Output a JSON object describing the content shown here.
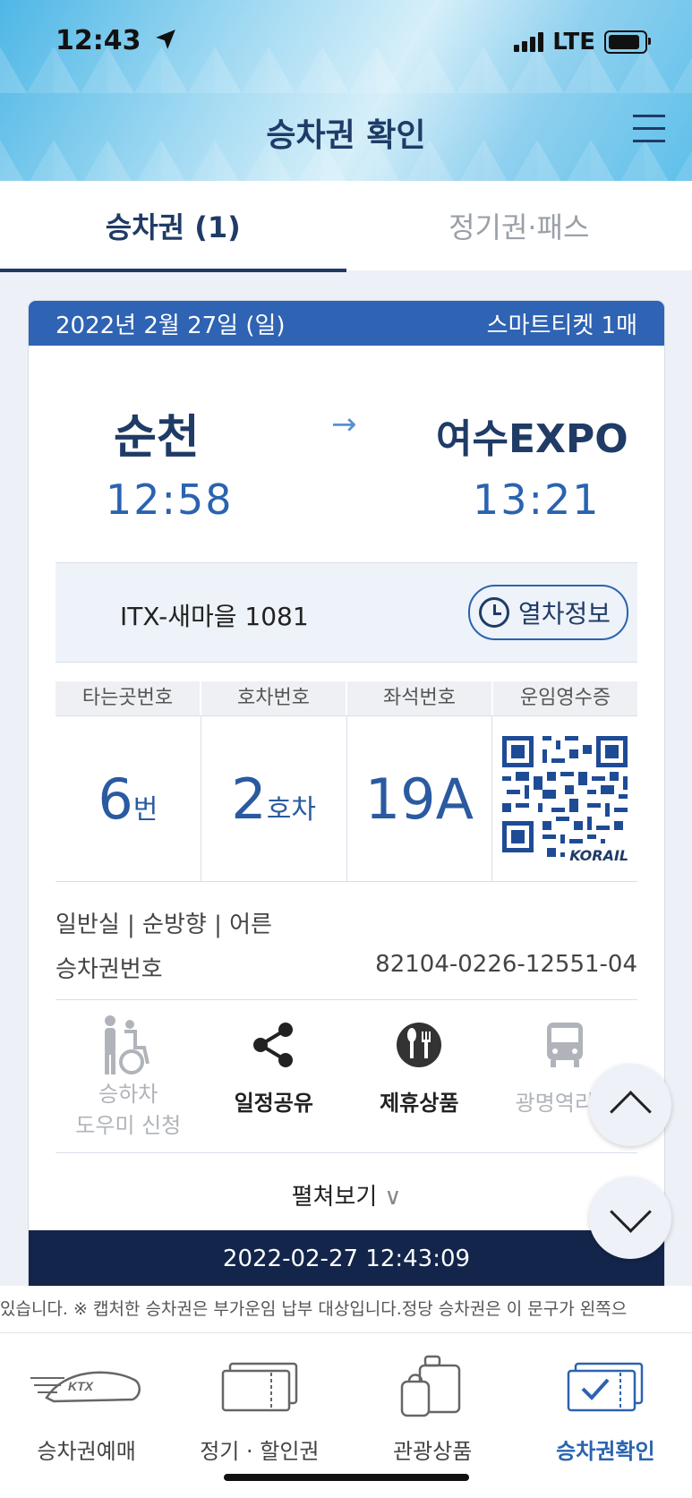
{
  "status": {
    "time": "12:43",
    "network": "LTE"
  },
  "header": {
    "title": "승차권 확인"
  },
  "tabs": [
    {
      "label": "승차권 (1)",
      "active": true
    },
    {
      "label": "정기권·패스",
      "active": false
    }
  ],
  "ticket": {
    "date": "2022년 2월 27일 (일)",
    "type_label": "스마트티켓 1매",
    "from_station": "순천",
    "to_station": "여수EXPO",
    "dep_time": "12:58",
    "arr_time": "13:21",
    "train_name": "ITX-새마을 1081",
    "train_info_button": "열차정보",
    "grid_headers": [
      "타는곳번호",
      "호차번호",
      "좌석번호",
      "운임영수증"
    ],
    "platform": {
      "value": "6",
      "unit": "번"
    },
    "car": {
      "value": "2",
      "unit": "호차"
    },
    "seat": "19A",
    "qr_brand": "KORAIL",
    "details": "일반실 | 순방향 | 어른",
    "ticket_no_label": "승차권번호",
    "ticket_no": "82104-0226-12551-04",
    "actions": [
      {
        "line1": "승하차",
        "line2": "도우미 신청",
        "icon": "wheelchair-icon"
      },
      {
        "line1": "일정공유",
        "icon": "share-icon"
      },
      {
        "line1": "제휴상품",
        "icon": "dining-icon"
      },
      {
        "line1": "광명역리무",
        "icon": "bus-icon"
      }
    ],
    "expand_label": "펼쳐보기",
    "expand_chevron": "∨",
    "timestamp": "2022-02-27 12:43:09"
  },
  "marquee": "있습니다. ※ 캡처한 승차권은 부가운임 납부 대상입니다.정당 승차권은 이 문구가 왼쪽으",
  "bottom_nav": [
    {
      "label": "승차권예매",
      "icon": "ktx-train-icon",
      "active": false
    },
    {
      "label": "정기 · 할인권",
      "icon": "ticket-icon",
      "active": false
    },
    {
      "label": "관광상품",
      "icon": "luggage-icon",
      "active": false
    },
    {
      "label": "승차권확인",
      "icon": "ticket-check-icon",
      "active": true
    }
  ],
  "colors": {
    "primary": "#1f3b66",
    "accent": "#2a63b0",
    "card_header": "#2f63b3",
    "card_footer": "#13254a"
  }
}
